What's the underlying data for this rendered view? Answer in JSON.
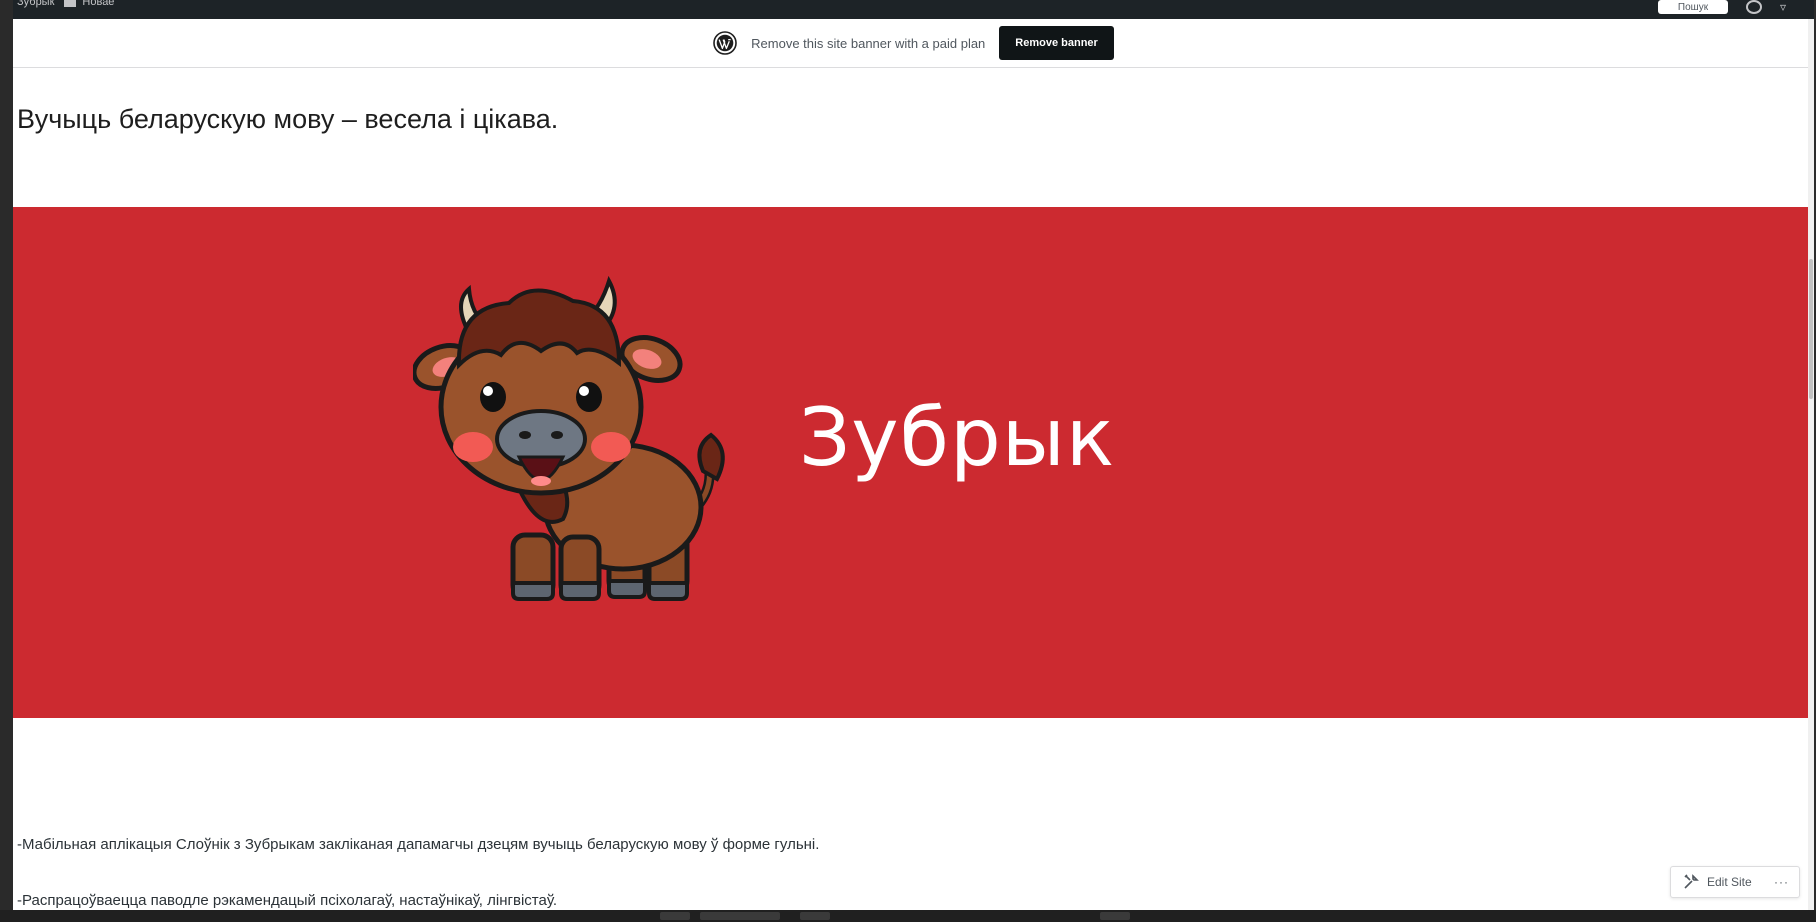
{
  "adminbar": {
    "left_items": [
      "Зубрык",
      "Новае"
    ],
    "search_label": "Пошук",
    "user_icon": "avatar-icon",
    "notifications_icon": "bell-icon"
  },
  "banner": {
    "logo_icon": "wordpress-logo",
    "text": "Remove this site banner with a paid plan",
    "button_label": "Remove banner"
  },
  "site": {
    "title": "Вучыць беларускую мову – весела і цікава."
  },
  "hero": {
    "background_color": "#cc2a30",
    "title": "Зубрык",
    "image": "bison-mascot"
  },
  "content": {
    "paragraphs": [
      "-Мабільная аплікацыя Слоўнік з Зубрыкам закліканая дапамагчы дзецям вучыць беларускую мову ў форме гульні.",
      "-Распрацоўваецца паводле рэкамендацый псіхолагаў, настаўнікаў, лінгвістаў."
    ]
  },
  "edit_site": {
    "label": "Edit Site",
    "icon": "tools-icon",
    "more": "···"
  }
}
